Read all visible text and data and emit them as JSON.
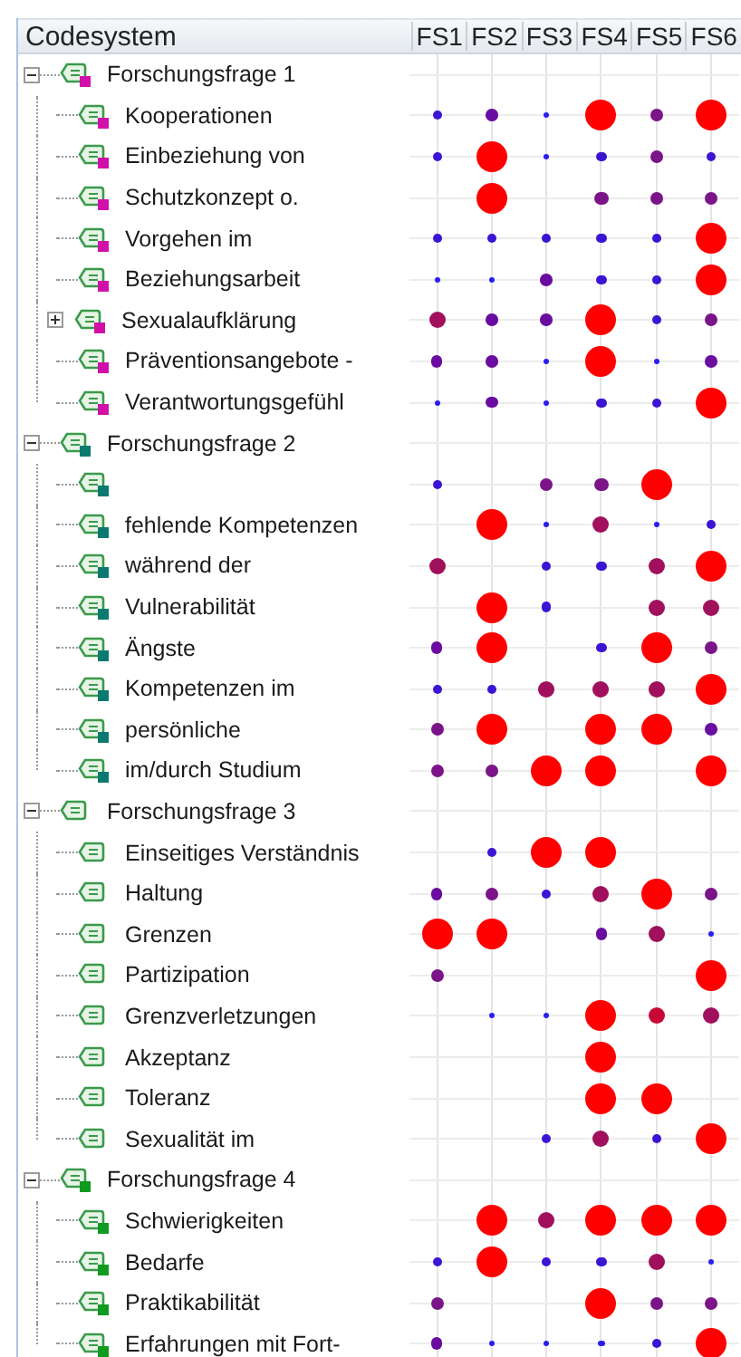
{
  "header": {
    "title": "Codesystem",
    "columns": [
      "FS1",
      "FS2",
      "FS3",
      "FS4",
      "FS5",
      "FS6"
    ]
  },
  "groups": [
    {
      "label": "Forschungsfrage 1",
      "color": "#d010a8",
      "expanded": true,
      "children": [
        {
          "label": "Kooperationen",
          "color": "#d010a8",
          "expandable": false,
          "cells": [
            {
              "level": 0.3,
              "color": "#3c14d4"
            },
            {
              "level": 0.4,
              "color": "#6a0ca0"
            },
            {
              "level": 0.18,
              "color": "#2b1ef0"
            },
            {
              "level": 1,
              "color": "#ff0000"
            },
            {
              "level": 0.42,
              "color": "#7a1488"
            },
            {
              "level": 1,
              "color": "#ff0000"
            }
          ]
        },
        {
          "label": "Einbeziehung von",
          "color": "#d010a8",
          "expandable": false,
          "cells": [
            {
              "level": 0.3,
              "color": "#3c14d4"
            },
            {
              "level": 1,
              "color": "#ff0000"
            },
            {
              "level": 0.18,
              "color": "#2b1ef0"
            },
            {
              "level": 0.3,
              "color": "#3c14d4"
            },
            {
              "level": 0.42,
              "color": "#7a1488"
            },
            {
              "level": 0.3,
              "color": "#3c14d4"
            }
          ]
        },
        {
          "label": "Schutzkonzept o.",
          "color": "#d010a8",
          "expandable": false,
          "cells": [
            null,
            {
              "level": 1,
              "color": "#ff0000"
            },
            null,
            {
              "level": 0.42,
              "color": "#7a1488"
            },
            {
              "level": 0.42,
              "color": "#7a1488"
            },
            {
              "level": 0.42,
              "color": "#7a1488"
            }
          ]
        },
        {
          "label": "Vorgehen im",
          "color": "#d010a8",
          "expandable": false,
          "cells": [
            {
              "level": 0.3,
              "color": "#3c14d4"
            },
            {
              "level": 0.3,
              "color": "#3c14d4"
            },
            {
              "level": 0.3,
              "color": "#3c14d4"
            },
            {
              "level": 0.3,
              "color": "#3c14d4"
            },
            {
              "level": 0.3,
              "color": "#3c14d4"
            },
            {
              "level": 1,
              "color": "#ff0000"
            }
          ]
        },
        {
          "label": "Beziehungsarbeit",
          "color": "#d010a8",
          "expandable": false,
          "cells": [
            {
              "level": 0.18,
              "color": "#2b1ef0"
            },
            {
              "level": 0.18,
              "color": "#2b1ef0"
            },
            {
              "level": 0.4,
              "color": "#6a0ca0"
            },
            {
              "level": 0.3,
              "color": "#3c14d4"
            },
            {
              "level": 0.3,
              "color": "#3c14d4"
            },
            {
              "level": 1,
              "color": "#ff0000"
            }
          ]
        },
        {
          "label": "Sexualaufklärung",
          "color": "#d010a8",
          "expandable": true,
          "cells": [
            {
              "level": 0.53,
              "color": "#a0105c"
            },
            {
              "level": 0.4,
              "color": "#6a0ca0"
            },
            {
              "level": 0.4,
              "color": "#6a0ca0"
            },
            {
              "level": 1,
              "color": "#ff0000"
            },
            {
              "level": 0.3,
              "color": "#3c14d4"
            },
            {
              "level": 0.42,
              "color": "#7a1488"
            }
          ]
        },
        {
          "label": "Präventionsangebote -",
          "color": "#d010a8",
          "expandable": false,
          "cells": [
            {
              "level": 0.4,
              "color": "#6a0ca0"
            },
            {
              "level": 0.4,
              "color": "#6a0ca0"
            },
            {
              "level": 0.18,
              "color": "#2b1ef0"
            },
            {
              "level": 1,
              "color": "#ff0000"
            },
            {
              "level": 0.18,
              "color": "#2b1ef0"
            },
            {
              "level": 0.4,
              "color": "#6a0ca0"
            }
          ]
        },
        {
          "label": "Verantwortungsgefühl",
          "color": "#d010a8",
          "expandable": false,
          "cells": [
            {
              "level": 0.18,
              "color": "#2b1ef0"
            },
            {
              "level": 0.4,
              "color": "#6a0ca0"
            },
            {
              "level": 0.18,
              "color": "#2b1ef0"
            },
            {
              "level": 0.3,
              "color": "#3c14d4"
            },
            {
              "level": 0.3,
              "color": "#3c14d4"
            },
            {
              "level": 1,
              "color": "#ff0000"
            }
          ]
        }
      ]
    },
    {
      "label": "Forschungsfrage 2",
      "color": "#0a7a70",
      "expanded": true,
      "children": [
        {
          "color": "#0a7a70",
          "expandable": false,
          "cells": [
            {
              "level": 0.3,
              "color": "#3c14d4"
            },
            null,
            {
              "level": 0.42,
              "color": "#7a1488"
            },
            {
              "level": 0.42,
              "color": "#7a1488"
            },
            {
              "level": 1,
              "color": "#ff0000"
            },
            null
          ]
        },
        {
          "label": "fehlende Kompetenzen",
          "color": "#0a7a70",
          "expandable": false,
          "cells": [
            null,
            {
              "level": 1,
              "color": "#ff0000"
            },
            {
              "level": 0.18,
              "color": "#2b1ef0"
            },
            {
              "level": 0.53,
              "color": "#a0105c"
            },
            {
              "level": 0.18,
              "color": "#2b1ef0"
            },
            {
              "level": 0.3,
              "color": "#3c14d4"
            }
          ]
        },
        {
          "label": "während der",
          "color": "#0a7a70",
          "expandable": false,
          "cells": [
            {
              "level": 0.53,
              "color": "#a0105c"
            },
            null,
            {
              "level": 0.3,
              "color": "#3c14d4"
            },
            {
              "level": 0.3,
              "color": "#3c14d4"
            },
            {
              "level": 0.53,
              "color": "#a0105c"
            },
            {
              "level": 1,
              "color": "#ff0000"
            }
          ]
        },
        {
          "label": "Vulnerabilität",
          "color": "#0a7a70",
          "expandable": false,
          "cells": [
            null,
            {
              "level": 1,
              "color": "#ff0000"
            },
            {
              "level": 0.3,
              "color": "#3c14d4"
            },
            null,
            {
              "level": 0.53,
              "color": "#a0105c"
            },
            {
              "level": 0.53,
              "color": "#a0105c"
            }
          ]
        },
        {
          "label": "Ängste",
          "color": "#0a7a70",
          "expandable": false,
          "cells": [
            {
              "level": 0.4,
              "color": "#6a0ca0"
            },
            {
              "level": 1,
              "color": "#ff0000"
            },
            null,
            {
              "level": 0.3,
              "color": "#3c14d4"
            },
            {
              "level": 1,
              "color": "#ff0000"
            },
            {
              "level": 0.42,
              "color": "#7a1488"
            }
          ]
        },
        {
          "label": "Kompetenzen im",
          "color": "#0a7a70",
          "expandable": false,
          "cells": [
            {
              "level": 0.3,
              "color": "#3c14d4"
            },
            {
              "level": 0.3,
              "color": "#3c14d4"
            },
            {
              "level": 0.53,
              "color": "#a0105c"
            },
            {
              "level": 0.53,
              "color": "#a0105c"
            },
            {
              "level": 0.53,
              "color": "#a0105c"
            },
            {
              "level": 1,
              "color": "#ff0000"
            }
          ]
        },
        {
          "label": "persönliche",
          "color": "#0a7a70",
          "expandable": false,
          "cells": [
            {
              "level": 0.42,
              "color": "#7a1488"
            },
            {
              "level": 1,
              "color": "#ff0000"
            },
            null,
            {
              "level": 1,
              "color": "#ff0000"
            },
            {
              "level": 1,
              "color": "#ff0000"
            },
            {
              "level": 0.4,
              "color": "#6a0ca0"
            }
          ]
        },
        {
          "label": "im/durch Studium",
          "color": "#0a7a70",
          "expandable": false,
          "cells": [
            {
              "level": 0.42,
              "color": "#7a1488"
            },
            {
              "level": 0.42,
              "color": "#7a1488"
            },
            {
              "level": 1,
              "color": "#ff0000"
            },
            {
              "level": 1,
              "color": "#ff0000"
            },
            null,
            {
              "level": 1,
              "color": "#ff0000"
            }
          ]
        }
      ]
    },
    {
      "label": "Forschungsfrage 3",
      "expanded": true,
      "children": [
        {
          "label": "Einseitiges Verständnis",
          "expandable": false,
          "cells": [
            null,
            {
              "level": 0.3,
              "color": "#3c14d4"
            },
            {
              "level": 1,
              "color": "#ff0000"
            },
            {
              "level": 1,
              "color": "#ff0000"
            },
            null,
            null
          ]
        },
        {
          "label": "Haltung",
          "expandable": false,
          "cells": [
            {
              "level": 0.4,
              "color": "#6a0ca0"
            },
            {
              "level": 0.42,
              "color": "#7a1488"
            },
            {
              "level": 0.3,
              "color": "#3c14d4"
            },
            {
              "level": 0.53,
              "color": "#a0105c"
            },
            {
              "level": 1,
              "color": "#ff0000"
            },
            {
              "level": 0.42,
              "color": "#7a1488"
            }
          ]
        },
        {
          "label": "Grenzen",
          "expandable": false,
          "cells": [
            {
              "level": 1,
              "color": "#ff0000"
            },
            {
              "level": 1,
              "color": "#ff0000"
            },
            null,
            {
              "level": 0.4,
              "color": "#6a0ca0"
            },
            {
              "level": 0.53,
              "color": "#a0105c"
            },
            {
              "level": 0.18,
              "color": "#2b1ef0"
            }
          ]
        },
        {
          "label": "Partizipation",
          "expandable": false,
          "cells": [
            {
              "level": 0.42,
              "color": "#7a1488"
            },
            null,
            null,
            null,
            null,
            {
              "level": 1,
              "color": "#ff0000"
            }
          ]
        },
        {
          "label": "Grenzverletzungen",
          "expandable": false,
          "cells": [
            null,
            {
              "level": 0.18,
              "color": "#2b1ef0"
            },
            {
              "level": 0.18,
              "color": "#2b1ef0"
            },
            {
              "level": 1,
              "color": "#ff0000"
            },
            {
              "level": 0.53,
              "color": "#c80834"
            },
            {
              "level": 0.53,
              "color": "#a0105c"
            }
          ]
        },
        {
          "label": "Akzeptanz",
          "expandable": false,
          "cells": [
            null,
            null,
            null,
            {
              "level": 1,
              "color": "#ff0000"
            },
            null,
            null
          ]
        },
        {
          "label": "Toleranz",
          "expandable": false,
          "cells": [
            null,
            null,
            null,
            {
              "level": 1,
              "color": "#ff0000"
            },
            {
              "level": 1,
              "color": "#ff0000"
            },
            null
          ]
        },
        {
          "label": "Sexualität im",
          "expandable": false,
          "cells": [
            null,
            null,
            {
              "level": 0.3,
              "color": "#3c14d4"
            },
            {
              "level": 0.53,
              "color": "#a0105c"
            },
            {
              "level": 0.3,
              "color": "#3c14d4"
            },
            {
              "level": 1,
              "color": "#ff0000"
            }
          ]
        }
      ]
    },
    {
      "label": "Forschungsfrage 4",
      "color": "#109a20",
      "expanded": true,
      "children": [
        {
          "label": "Schwierigkeiten",
          "color": "#109a20",
          "expandable": false,
          "cells": [
            null,
            {
              "level": 1,
              "color": "#ff0000"
            },
            {
              "level": 0.53,
              "color": "#a0105c"
            },
            {
              "level": 1,
              "color": "#ff0000"
            },
            {
              "level": 1,
              "color": "#ff0000"
            },
            {
              "level": 1,
              "color": "#ff0000"
            }
          ]
        },
        {
          "label": "Bedarfe",
          "color": "#109a20",
          "expandable": false,
          "cells": [
            {
              "level": 0.3,
              "color": "#3c14d4"
            },
            {
              "level": 1,
              "color": "#ff0000"
            },
            {
              "level": 0.3,
              "color": "#3c14d4"
            },
            {
              "level": 0.3,
              "color": "#3c14d4"
            },
            {
              "level": 0.53,
              "color": "#a0105c"
            },
            {
              "level": 0.18,
              "color": "#2b1ef0"
            }
          ]
        },
        {
          "label": "Praktikabilität",
          "color": "#109a20",
          "expandable": false,
          "cells": [
            {
              "level": 0.42,
              "color": "#7a1488"
            },
            null,
            null,
            {
              "level": 1,
              "color": "#ff0000"
            },
            {
              "level": 0.42,
              "color": "#7a1488"
            },
            {
              "level": 0.42,
              "color": "#7a1488"
            }
          ]
        },
        {
          "label": "Erfahrungen mit Fort-",
          "color": "#109a20",
          "expandable": false,
          "cells": [
            {
              "level": 0.4,
              "color": "#6a0ca0"
            },
            {
              "level": 0.18,
              "color": "#2b1ef0"
            },
            {
              "level": 0.18,
              "color": "#2b1ef0"
            },
            {
              "level": 0.18,
              "color": "#2b1ef0"
            },
            {
              "level": 0.3,
              "color": "#3c14d4"
            },
            {
              "level": 1,
              "color": "#ff0000"
            }
          ]
        }
      ]
    }
  ]
}
